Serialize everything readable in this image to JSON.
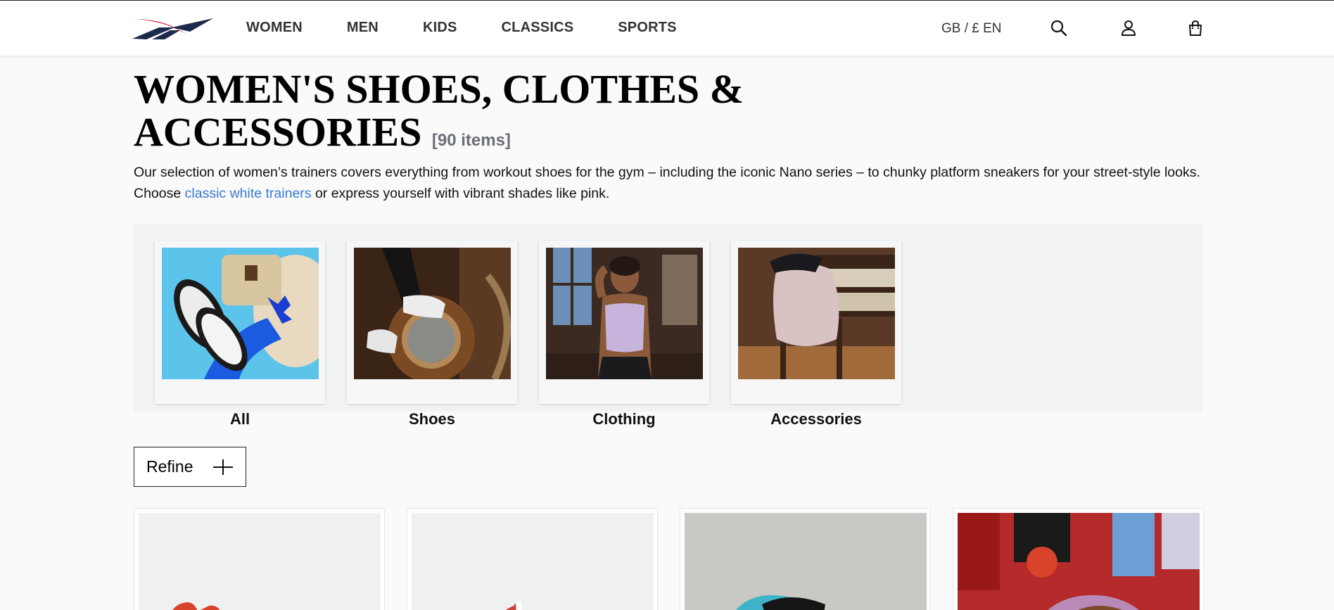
{
  "header": {
    "nav": [
      "WOMEN",
      "MEN",
      "KIDS",
      "CLASSICS",
      "SPORTS"
    ],
    "locale": "GB / £ EN",
    "icons": [
      "search-icon",
      "account-icon",
      "bag-icon"
    ],
    "brand_colors": [
      "#c8102e",
      "#1b2a4a"
    ]
  },
  "page": {
    "title": "WOMEN'S SHOES, CLOTHES & ACCESSORIES",
    "item_count": "[90 items]",
    "description_before": "Our selection of women’s trainers covers everything from workout shoes for the gym – including the iconic Nano series – to chunky platform sneakers for your street-style looks. Choose ",
    "description_link": "classic white trainers",
    "description_after": " or express yourself with vibrant shades like pink.",
    "link_color": "#3a7bd5"
  },
  "categories": [
    {
      "label": "All"
    },
    {
      "label": "Shoes"
    },
    {
      "label": "Clothing"
    },
    {
      "label": "Accessories"
    }
  ],
  "refine": {
    "label": "Refine"
  }
}
